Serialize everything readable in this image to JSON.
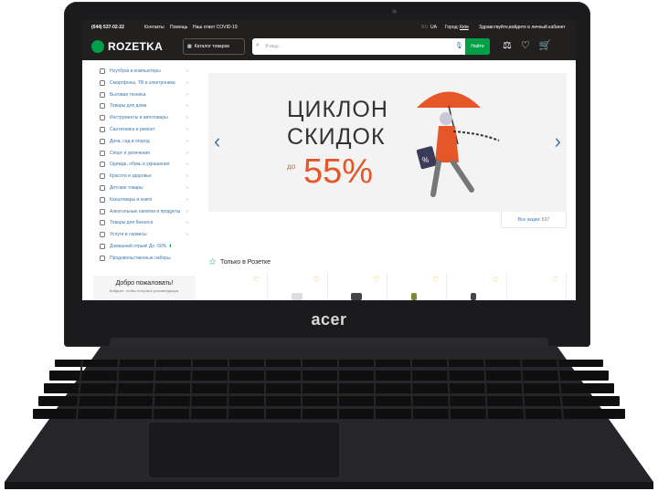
{
  "device": {
    "brand": "acer"
  },
  "topbar": {
    "phone": "(044) 537-02-22",
    "contacts": "Контакты",
    "help": "Помощь",
    "covid": "Наш ответ COVID-19",
    "lang_ru": "RU",
    "lang_ua": "UA",
    "city_label": "Город:",
    "city": "Київ",
    "greeting": "Здравствуйте,",
    "login": "войдите в личный кабинет"
  },
  "header": {
    "logo": "ROZETKA",
    "catalog_label": "Каталог товаров",
    "search_placeholder": "Я ищу...",
    "search_button": "Найти",
    "accent": "#00a046",
    "bg": "#221f1f"
  },
  "sidebar": {
    "items": [
      {
        "label": "Ноутбуки и компьютеры",
        "chevron": true
      },
      {
        "label": "Смартфоны, ТВ и электроника",
        "chevron": true
      },
      {
        "label": "Бытовая техника",
        "chevron": true
      },
      {
        "label": "Товары для дома",
        "chevron": true
      },
      {
        "label": "Инструменты и автотовары",
        "chevron": true
      },
      {
        "label": "Сантехника и ремонт",
        "chevron": true
      },
      {
        "label": "Дача, сад и огород",
        "chevron": true
      },
      {
        "label": "Спорт и увлечения",
        "chevron": true
      },
      {
        "label": "Одежда, обувь и украшения",
        "chevron": true
      },
      {
        "label": "Красота и здоровье",
        "chevron": true
      },
      {
        "label": "Детские товары",
        "chevron": true
      },
      {
        "label": "Канцтовары и книги",
        "chevron": true
      },
      {
        "label": "Алкогольные напитки и продукты",
        "chevron": true
      },
      {
        "label": "Товары для бизнеса",
        "chevron": true
      },
      {
        "label": "Услуги и сервисы",
        "chevron": true
      },
      {
        "label": "Домашний отрыв! До -50%",
        "chevron": false
      },
      {
        "label": "Продовольственные наборы",
        "chevron": false
      }
    ],
    "welcome_title": "Добро пожаловать!",
    "welcome_sub": "Войдите, чтобы получать рекомендации,"
  },
  "banner": {
    "line1": "ЦИКЛОН",
    "line2": "СКИДОК",
    "prefix": "до",
    "value": "55%",
    "accent": "#e65626"
  },
  "promos": {
    "label": "Все акции:",
    "count": "637"
  },
  "section": {
    "title": "Только в Розетке"
  }
}
